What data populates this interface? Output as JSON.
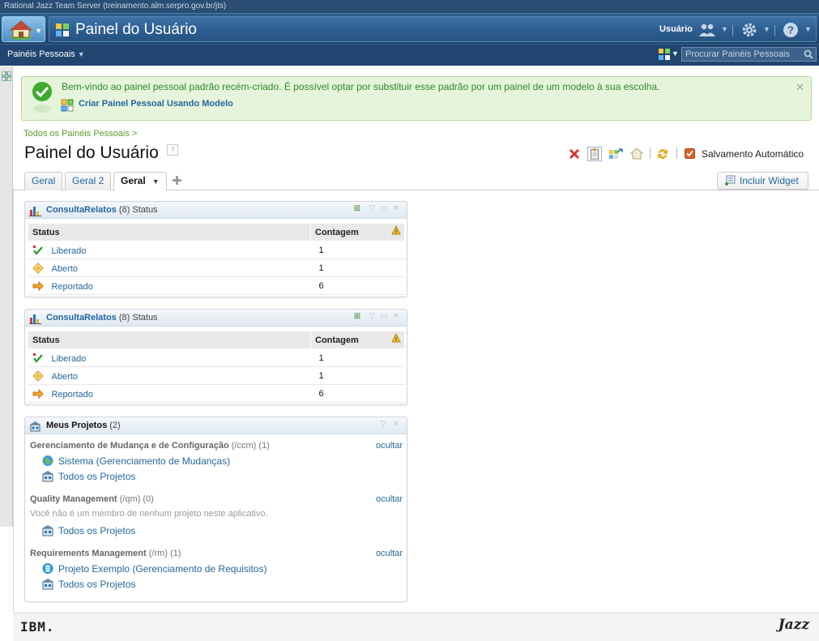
{
  "window": {
    "title": "Rational Jazz Team Server (treinamento.alm.serpro.gov.br/jts)"
  },
  "banner": {
    "title": "Painel do Usuário",
    "user_label": "Usuário"
  },
  "nav": {
    "personal_dashboards": "Painéis Pessoais",
    "search_placeholder": "Procurar Painéis Pessoais"
  },
  "welcome": {
    "message": "Bem-vindo ao painel pessoal padrão recém-criado. É possível optar por substituir esse padrão por um painel de um modelo à sua escolha.",
    "link": "Criar Painel Pessoal Usando Modelo",
    "close": "✕"
  },
  "breadcrumb": "Todos os Painéis Pessoais >",
  "page_title": "Painel do Usuário",
  "help_mark": "?",
  "toolbar": {
    "autosave_label": "Salvamento Automático"
  },
  "tabs": [
    {
      "label": "Geral"
    },
    {
      "label": "Geral 2"
    },
    {
      "label": "Geral"
    }
  ],
  "add_widget": "Incluir Widget",
  "query_widgets": [
    {
      "name": "ConsultaRelatos",
      "count": "(8)",
      "suffix": "Status",
      "columns": [
        "Status",
        "Contagem"
      ],
      "rows": [
        {
          "status": "Liberado",
          "count": "1"
        },
        {
          "status": "Aberto",
          "count": "1"
        },
        {
          "status": "Reportado",
          "count": "6"
        }
      ]
    },
    {
      "name": "ConsultaRelatos",
      "count": "(8)",
      "suffix": "Status",
      "columns": [
        "Status",
        "Contagem"
      ],
      "rows": [
        {
          "status": "Liberado",
          "count": "1"
        },
        {
          "status": "Aberto",
          "count": "1"
        },
        {
          "status": "Reportado",
          "count": "6"
        }
      ]
    }
  ],
  "projects_widget": {
    "title": "Meus Projetos",
    "count": "(2)",
    "sections": [
      {
        "name": "Gerenciamento de Mudança e de Configuração",
        "path": "(/ccm)",
        "count": "(1)",
        "hide": "ocultar",
        "items": [
          "Sistema (Gerenciamento de Mudanças)",
          "Todos os Projetos"
        ]
      },
      {
        "name": "Quality Management",
        "path": "(/qm)",
        "count": "(0)",
        "hide": "ocultar",
        "note": "Você não é um membro de nenhum projeto neste aplicativo.",
        "items": [
          "Todos os Projetos"
        ]
      },
      {
        "name": "Requirements Management",
        "path": "(/rm)",
        "count": "(1)",
        "hide": "ocultar",
        "items": [
          "Projeto Exemplo (Gerenciamento de Requisitos)",
          "Todos os Projetos"
        ]
      }
    ]
  },
  "footer": {
    "ibm": "IBM.",
    "jazz": "Jazz"
  },
  "colors": {
    "banner": "#2d5d8e",
    "link": "#24679d",
    "welcome_bg": "#e5f4da",
    "welcome_text": "#2d8a2d"
  }
}
